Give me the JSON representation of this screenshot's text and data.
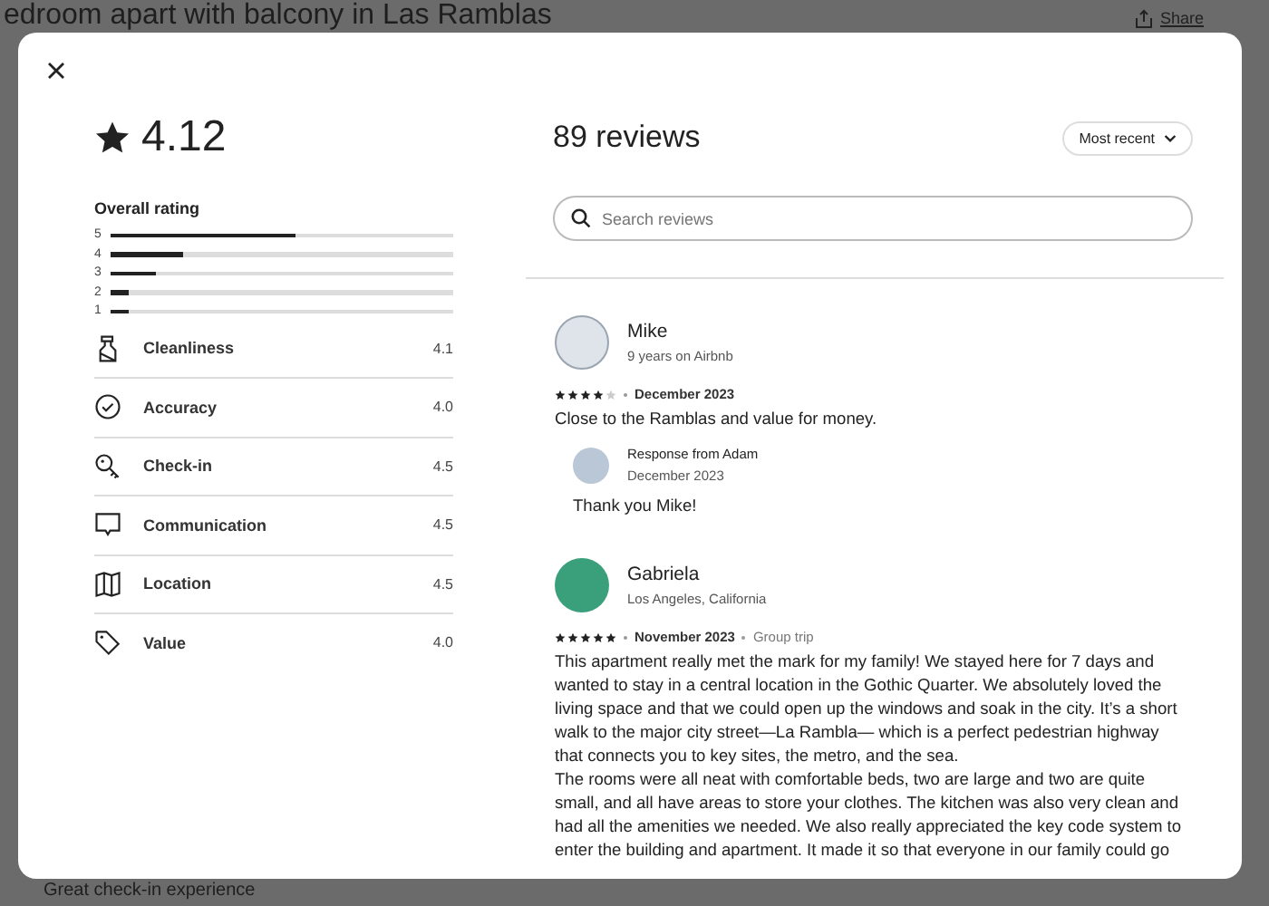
{
  "page": {
    "title": "edroom apart with balcony in Las Ramblas",
    "share": "Share",
    "footer_text": "Great check-in experience"
  },
  "modal": {
    "rating": "4.12",
    "overall_label": "Overall rating",
    "distribution": [
      {
        "label": "5",
        "level": 0.54
      },
      {
        "label": "4",
        "level": 0.21
      },
      {
        "label": "3",
        "level": 0.13
      },
      {
        "label": "2",
        "level": 0.055
      },
      {
        "label": "1",
        "level": 0.055
      }
    ],
    "categories": [
      {
        "name": "Cleanliness",
        "score": "4.1"
      },
      {
        "name": "Accuracy",
        "score": "4.0"
      },
      {
        "name": "Check-in",
        "score": "4.5"
      },
      {
        "name": "Communication",
        "score": "4.5"
      },
      {
        "name": "Location",
        "score": "4.5"
      },
      {
        "name": "Value",
        "score": "4.0"
      }
    ],
    "review_count": "89 reviews",
    "sort": "Most recent",
    "search": {
      "placeholder": "Search reviews"
    },
    "reviews": [
      {
        "name": "Mike",
        "subtitle": "9 years on Airbnb",
        "stars": 4,
        "date": "December 2023",
        "body": "Close to the Ramblas and value for money.",
        "response": {
          "title": "Response from Adam",
          "date": "December 2023",
          "body": "Thank you Mike!"
        }
      },
      {
        "name": "Gabriela",
        "subtitle": "Los Angeles, California",
        "stars": 5,
        "date": "November 2023",
        "trip": "Group trip",
        "body": "This apartment really met the mark for my family! We stayed here for 7 days and wanted to stay in a central location in the Gothic Quarter. We absolutely loved the living space and that we could open up the windows and soak in the city. It’s a short walk to the major city street—La Rambla— which is a perfect pedestrian highway that connects you to key sites, the metro, and the sea.\nThe rooms were all neat with comfortable beds, two are large and two are quite small, and all have areas to store your clothes. The kitchen was also very clean and had all the amenities we needed. We also really appreciated the key code system to enter the building and apartment. It made it so that everyone in our family could go"
      }
    ]
  }
}
